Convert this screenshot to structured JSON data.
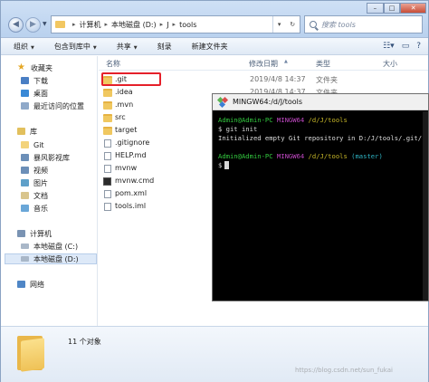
{
  "address": {
    "crumbs": [
      "计算机",
      "本地磁盘 (D:)",
      "J",
      "tools"
    ]
  },
  "search": {
    "placeholder": "搜索 tools"
  },
  "toolbar": {
    "organize": "组织",
    "include": "包含到库中",
    "share": "共享",
    "burn": "刻录",
    "new_folder": "新建文件夹"
  },
  "nav": {
    "favorites": "收藏夹",
    "downloads": "下载",
    "desktop": "桌面",
    "recent": "最近访问的位置",
    "libraries": "库",
    "git": "Git",
    "storm": "暴风影视库",
    "videos": "视频",
    "pictures": "图片",
    "documents": "文档",
    "music": "音乐",
    "computer": "计算机",
    "drive_c": "本地磁盘 (C:)",
    "drive_d": "本地磁盘 (D:)",
    "network": "网络"
  },
  "columns": {
    "name": "名称",
    "date": "修改日期",
    "type": "类型",
    "size": "大小"
  },
  "files": [
    {
      "name": ".git",
      "date": "2019/4/8 14:37",
      "type": "文件夹"
    },
    {
      "name": ".idea",
      "date": "2019/4/8 14:37",
      "type": "文件夹"
    },
    {
      "name": ".mvn",
      "date": "",
      "type": ""
    },
    {
      "name": "src",
      "date": "",
      "type": ""
    },
    {
      "name": "target",
      "date": "",
      "type": ""
    },
    {
      "name": ".gitignore",
      "date": "",
      "type": ""
    },
    {
      "name": "HELP.md",
      "date": "",
      "type": ""
    },
    {
      "name": "mvnw",
      "date": "",
      "type": ""
    },
    {
      "name": "mvnw.cmd",
      "date": "",
      "type": ""
    },
    {
      "name": "pom.xml",
      "date": "",
      "type": ""
    },
    {
      "name": "tools.iml",
      "date": "",
      "type": ""
    }
  ],
  "details": {
    "count": "11 个对象"
  },
  "terminal": {
    "title": "MINGW64:/d/J/tools",
    "user": "Admin@Admin-PC",
    "shell": "MINGW64",
    "path": "/d/J/tools",
    "cmd_prompt": "$ ",
    "command": "git init",
    "output": "Initialized empty Git repository in D:/J/tools/.git/",
    "branch": "(master)",
    "prompt": "$"
  },
  "watermark": "https://blog.csdn.net/sun_fukai",
  "colors": {
    "terminal_green": "#33c93f",
    "terminal_magenta": "#c148c3",
    "terminal_yellow": "#c6b628",
    "terminal_cyan": "#2fb4c4",
    "highlight_red": "#e5202a"
  }
}
